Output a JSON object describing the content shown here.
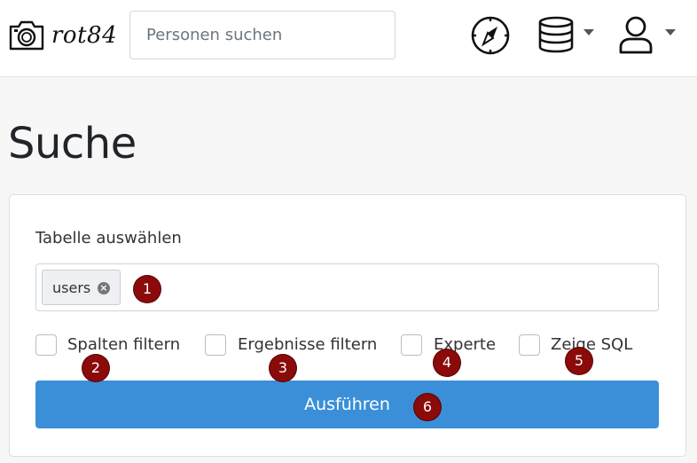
{
  "brand": {
    "name": "rot84",
    "logo_icon": "camera-icon"
  },
  "search": {
    "placeholder": "Personen suchen",
    "value": ""
  },
  "nav": {
    "icons": [
      "compass-icon",
      "database-icon",
      "user-icon"
    ]
  },
  "page": {
    "title": "Suche"
  },
  "form": {
    "table_label": "Tabelle auswählen",
    "selected_table": "users",
    "checkboxes": [
      {
        "label": "Spalten filtern",
        "checked": false
      },
      {
        "label": "Ergebnisse filtern",
        "checked": false
      },
      {
        "label": "Experte",
        "checked": false
      },
      {
        "label": "Zeige SQL",
        "checked": false
      }
    ],
    "run_label": "Ausführen"
  },
  "markers": [
    "1",
    "2",
    "3",
    "4",
    "5",
    "6"
  ],
  "colors": {
    "primary": "#3a8fd8",
    "marker": "#8b0a0a",
    "background": "#f7f7f7"
  }
}
